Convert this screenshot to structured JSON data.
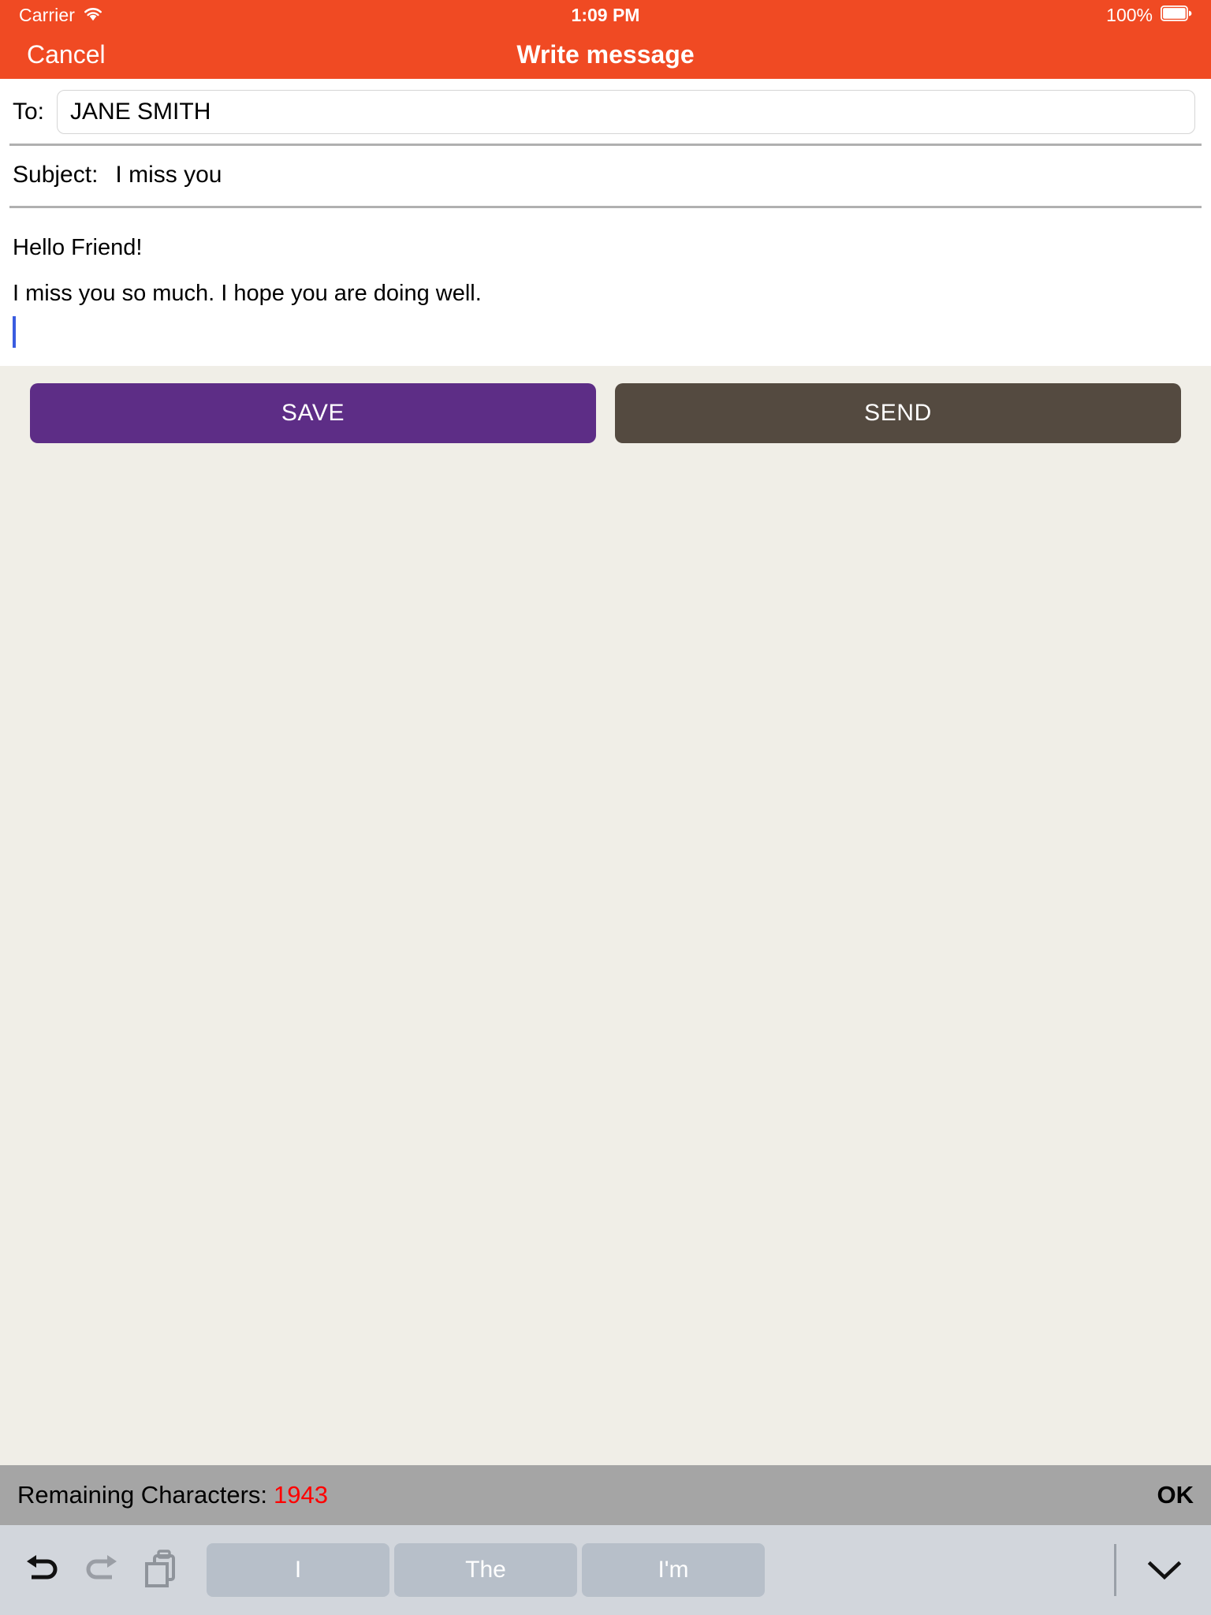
{
  "status_bar": {
    "carrier": "Carrier",
    "wifi_icon": "wifi-icon",
    "time": "1:09 PM",
    "battery_percent": "100%",
    "battery_icon": "battery-full-icon"
  },
  "nav_bar": {
    "cancel_label": "Cancel",
    "title": "Write message"
  },
  "compose": {
    "to_label": "To:",
    "to_value": "JANE SMITH",
    "to_placeholder": "",
    "subject_label": "Subject:",
    "subject_value": "I miss you",
    "subject_placeholder": "",
    "body_line_1": "Hello Friend!",
    "body_line_2": "I miss you so much. I hope you are doing well.",
    "body_line_3": ""
  },
  "actions": {
    "save_label": "SAVE",
    "send_label": "SEND",
    "save_color": "#5d2d86",
    "send_color": "#544a40"
  },
  "info_bar": {
    "remaining_label": "Remaining Characters:",
    "remaining_count": "1943",
    "count_color": "#ff0000",
    "ok_label": "OK"
  },
  "keyboard_bar": {
    "undo_icon": "undo-icon",
    "redo_icon": "redo-icon",
    "paste_icon": "paste-icon",
    "suggestions": [
      {
        "label": "I"
      },
      {
        "label": "The"
      },
      {
        "label": "I'm"
      }
    ],
    "dismiss_icon": "chevron-down-icon"
  },
  "theme": {
    "accent": "#f04a23",
    "page_background": "#f0eee7",
    "info_bar_background": "#a5a5a5",
    "keyboard_background": "#d2d6dc"
  }
}
